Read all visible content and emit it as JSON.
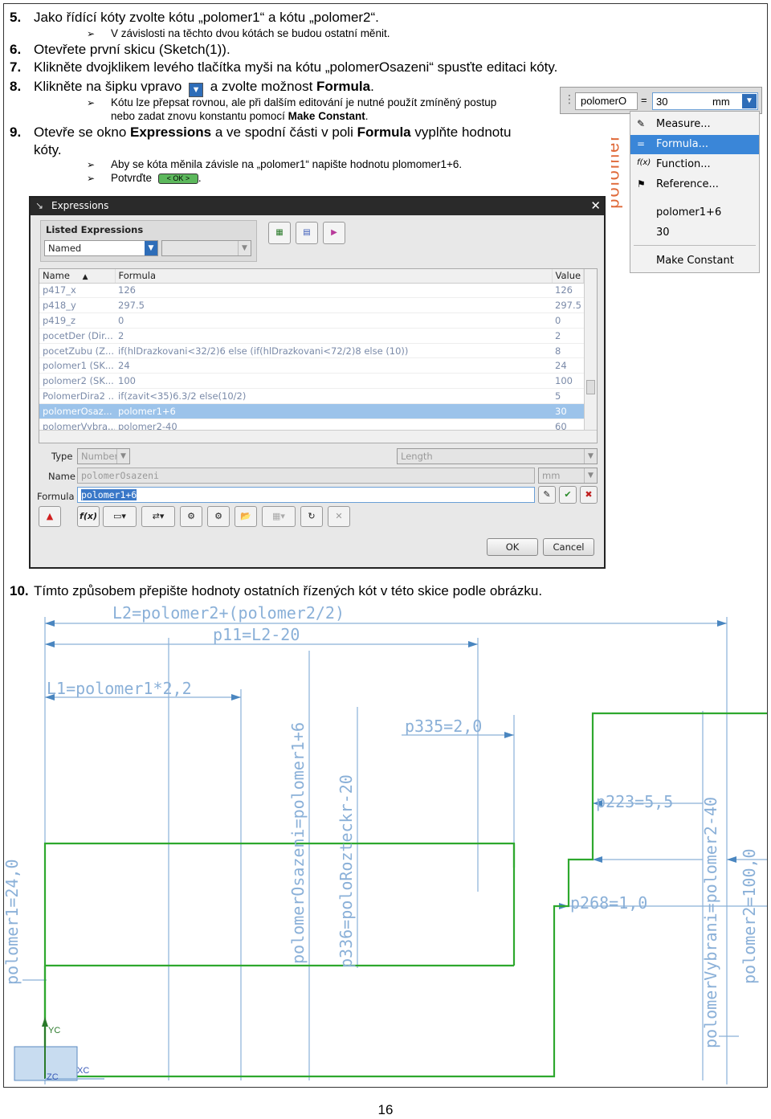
{
  "steps": {
    "s5": {
      "num": "5.",
      "text": "Jako řídící kóty zvolte kótu „polomer1“ a kótu „polomer2“.",
      "sub": "V závislosti na těchto dvou kótách se budou ostatní měnit."
    },
    "s6": {
      "num": "6.",
      "text": "Otevřete první skicu (Sketch(1))."
    },
    "s7": {
      "num": "7.",
      "text": "Klikněte dvojklikem levého tlačítka myši na kótu „polomerOsazeni“ spusťte editaci kóty."
    },
    "s8": {
      "num": "8.",
      "pre": "Klikněte na šipku vpravo",
      "mid": "a zvolte možnost",
      "bold": "Formula",
      "post": ".",
      "sub1": "Kótu lze přepsat rovnou, ale při dalším editování je nutné použít zmíněný postup",
      "sub2a": "nebo zadat znovu konstantu pomocí",
      "sub2b": "Make Constant",
      "sub2c": "."
    },
    "s9": {
      "num": "9.",
      "pre": "Otevře se okno",
      "b1": "Expressions",
      "mid": "a ve spodní části v poli",
      "b2": "Formula",
      "post": "vyplňte hodnotu",
      "line2": "kóty.",
      "sub1": "Aby se kóta měnila závisle na „polomer1“ napište hodnotu plomomer1+6.",
      "sub2": "Potvrďte",
      "ok_img": "< OK >",
      "dot": "."
    },
    "s10": {
      "num": "10.",
      "text": "Tímto způsobem přepište hodnoty ostatních řízených kót v této skice podle obrázku."
    }
  },
  "dialog": {
    "title": "Expressions",
    "group_title": "Listed Expressions",
    "listed_value": "Named",
    "columns": [
      "Name",
      "Formula",
      "Value"
    ],
    "rows": [
      {
        "name": "p417_x",
        "formula": "126",
        "value": "126"
      },
      {
        "name": "p418_y",
        "formula": "297.5",
        "value": "297.5"
      },
      {
        "name": "p419_z",
        "formula": "0",
        "value": "0"
      },
      {
        "name": "pocetDer (Dir...",
        "formula": "2",
        "value": "2"
      },
      {
        "name": "pocetZubu (Z...",
        "formula": "if(hlDrazkovani<32/2)6 else (if(hlDrazkovani<72/2)8 else (10))",
        "value": "8"
      },
      {
        "name": "polomer1 (SK...",
        "formula": "24",
        "value": "24"
      },
      {
        "name": "polomer2 (SK...",
        "formula": "100",
        "value": "100"
      },
      {
        "name": "PolomerDira2 ...",
        "formula": "if(zavit<35)6.3/2 else(10/2)",
        "value": "5"
      },
      {
        "name": "polomerOsaz...",
        "formula": "polomer1+6",
        "value": "30",
        "selected": true
      },
      {
        "name": "polomerVybra...",
        "formula": "polomer2-40",
        "value": "60"
      }
    ],
    "type_label": "Type",
    "type_value": "Number",
    "unit_type": "Length",
    "name_label": "Name",
    "name_value": "polomerOsazeni",
    "unit": "mm",
    "formula_label": "Formula",
    "formula_value": "polomer1+6",
    "ok": "OK",
    "cancel": "Cancel"
  },
  "popup": {
    "field_name": "polomerO",
    "eq": "=",
    "field_value": "30",
    "unit": "mm",
    "items": [
      "Measure...",
      "Formula...",
      "Function...",
      "Reference...",
      "polomer1+6",
      "30",
      "Make Constant"
    ]
  },
  "sketch": {
    "labels": {
      "l2": "L2=polomer2+(polomer2/2)",
      "p11": "p11=L2-20",
      "l1": "L1=polomer1*2,2",
      "p335": "p335=2,0",
      "p223": "p223=5,5",
      "p268": "p268=1,0",
      "v_polomer1": "polomer1=24,0",
      "v_osazeni": "polomerOsazeni=polomer1+6",
      "v_p336": "p336=poloRozteckr-20",
      "v_vybrani": "polomerVybrani=polomer2-40",
      "v_polomer2": "polomer2=100,0",
      "yc": "YC",
      "xc": "XC",
      "zc": "ZC"
    }
  },
  "page_number": "16"
}
